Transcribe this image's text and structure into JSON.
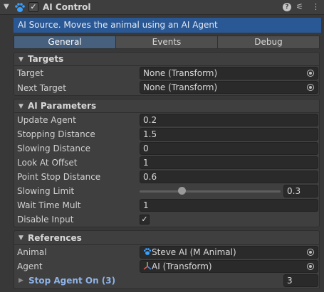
{
  "header": {
    "title": "AI Control",
    "enabled": "✓",
    "help_icon": "question-icon",
    "preset_icon": "sliders-icon",
    "menu_icon": "kebab-menu-icon"
  },
  "description": "AI Source. Moves the animal using an AI Agent",
  "tabs": [
    "General",
    "Events",
    "Debug"
  ],
  "targets": {
    "title": "Targets",
    "target_label": "Target",
    "target_value": "None (Transform)",
    "next_target_label": "Next Target",
    "next_target_value": "None (Transform)"
  },
  "ai_parameters": {
    "title": "AI Parameters",
    "rows": [
      {
        "label": "Update Agent",
        "value": "0.2"
      },
      {
        "label": "Stopping Distance",
        "value": "1.5"
      },
      {
        "label": "Slowing Distance",
        "value": "0"
      },
      {
        "label": "Look At Offset",
        "value": "1"
      },
      {
        "label": "Point Stop Distance",
        "value": "0.6"
      }
    ],
    "slowing_limit_label": "Slowing Limit",
    "slowing_limit_value": "0.3",
    "slowing_limit_fraction": 0.3,
    "wait_time_label": "Wait Time Mult",
    "wait_time_value": "1",
    "disable_input_label": "Disable Input",
    "disable_input_checked": "✓"
  },
  "references": {
    "title": "References",
    "animal_label": "Animal",
    "animal_value": "Steve AI (M Animal)",
    "agent_label": "Agent",
    "agent_value": "AI (Transform)",
    "stop_agent_label": "Stop Agent On (3)",
    "stop_agent_count": "3"
  },
  "colors": {
    "accent": "#2a5894",
    "active_tab": "#46607e",
    "link": "#8fb3e8"
  }
}
